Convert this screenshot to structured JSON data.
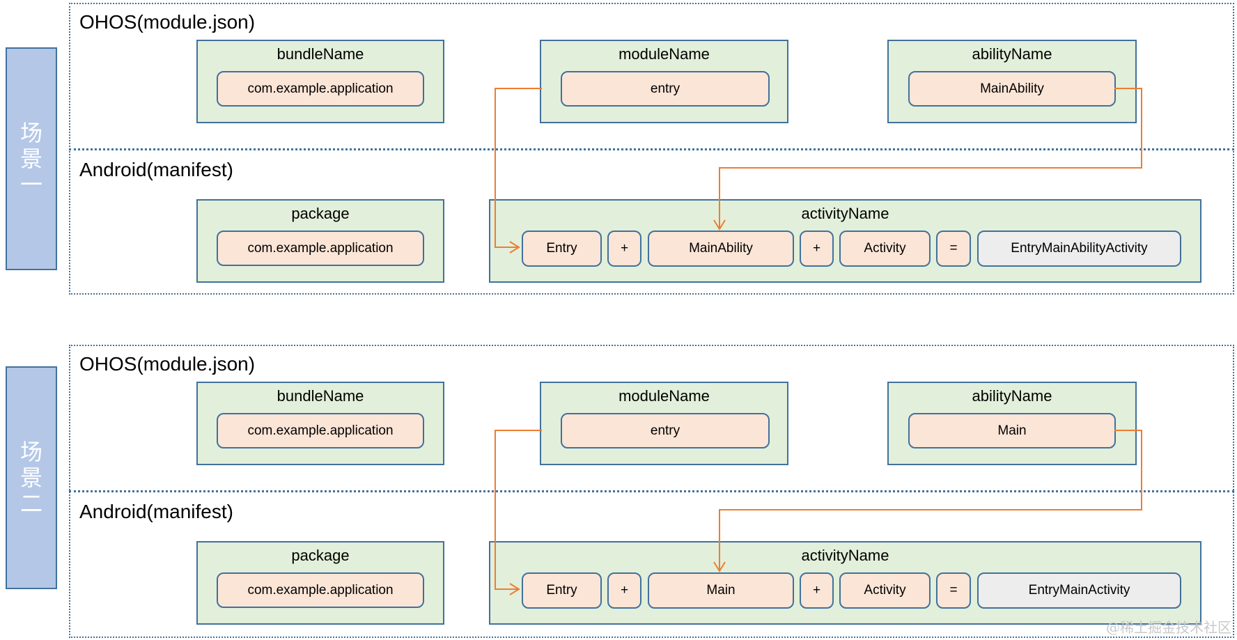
{
  "scenarios": [
    {
      "label_chars": [
        "场",
        "景",
        "一"
      ],
      "ohos": {
        "title": "OHOS(module.json)",
        "bundle": {
          "label": "bundleName",
          "value": "com.example.application"
        },
        "module": {
          "label": "moduleName",
          "value": "entry"
        },
        "ability": {
          "label": "abilityName",
          "value": "MainAbility"
        }
      },
      "android": {
        "title": "Android(manifest)",
        "package": {
          "label": "package",
          "value": "com.example.application"
        },
        "activity": {
          "label": "activityName",
          "parts": [
            "Entry",
            "+",
            "MainAbility",
            "+",
            "Activity",
            "="
          ],
          "result": "EntryMainAbilityActivity"
        }
      }
    },
    {
      "label_chars": [
        "场",
        "景",
        "二"
      ],
      "ohos": {
        "title": "OHOS(module.json)",
        "bundle": {
          "label": "bundleName",
          "value": "com.example.application"
        },
        "module": {
          "label": "moduleName",
          "value": "entry"
        },
        "ability": {
          "label": "abilityName",
          "value": "Main"
        }
      },
      "android": {
        "title": "Android(manifest)",
        "package": {
          "label": "package",
          "value": "com.example.application"
        },
        "activity": {
          "label": "activityName",
          "parts": [
            "Entry",
            "+",
            "Main",
            "+",
            "Activity",
            "="
          ],
          "result": "EntryMainActivity"
        }
      }
    }
  ],
  "colors": {
    "box_fill": "#E2EFDA",
    "border": "#41719C",
    "pill_fill": "#FBE5D6",
    "result_fill": "#EDEDED",
    "sidebar_fill": "#B4C7E7",
    "arrow": "#ED7D31"
  },
  "watermark": "@稀土掘金技术社区"
}
